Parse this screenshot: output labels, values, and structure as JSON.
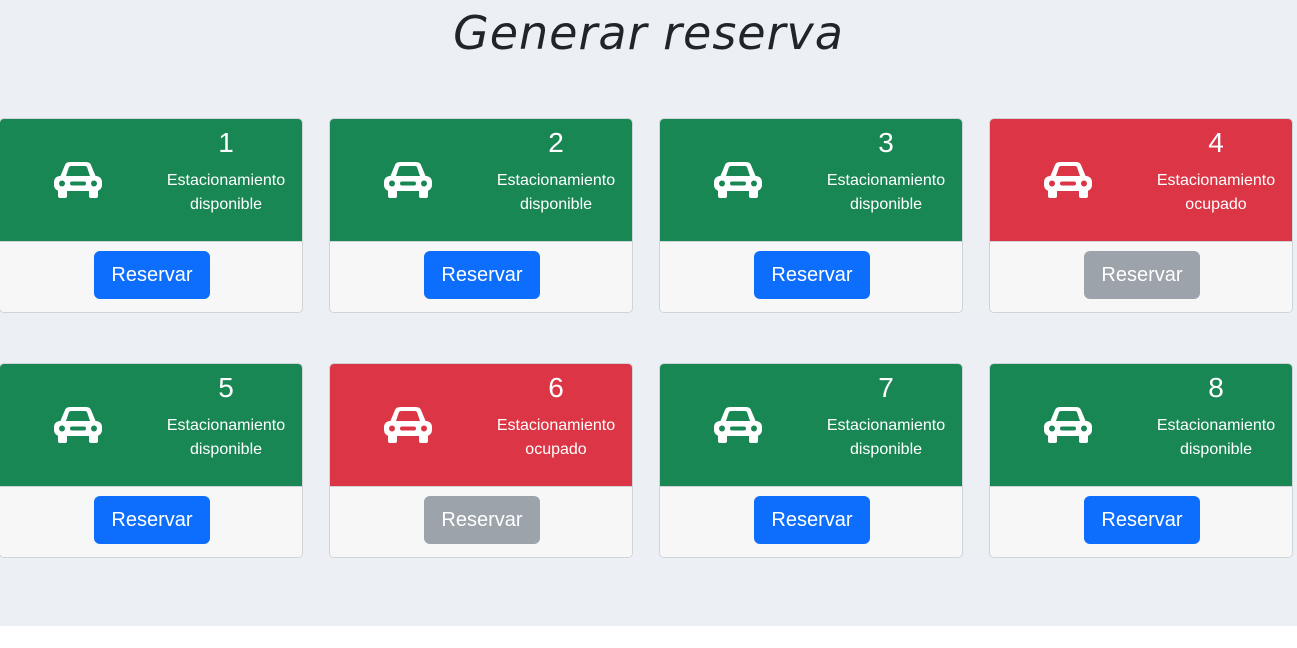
{
  "title": "Generar reserva",
  "spots": [
    {
      "number": "1",
      "status_line1": "Estacionamiento",
      "status_line2": "disponible",
      "state": "free",
      "button_label": "Reservar"
    },
    {
      "number": "2",
      "status_line1": "Estacionamiento",
      "status_line2": "disponible",
      "state": "free",
      "button_label": "Reservar"
    },
    {
      "number": "3",
      "status_line1": "Estacionamiento",
      "status_line2": "disponible",
      "state": "free",
      "button_label": "Reservar"
    },
    {
      "number": "4",
      "status_line1": "Estacionamiento",
      "status_line2": "ocupado",
      "state": "busy",
      "button_label": "Reservar"
    },
    {
      "number": "5",
      "status_line1": "Estacionamiento",
      "status_line2": "disponible",
      "state": "free",
      "button_label": "Reservar"
    },
    {
      "number": "6",
      "status_line1": "Estacionamiento",
      "status_line2": "ocupado",
      "state": "busy",
      "button_label": "Reservar"
    },
    {
      "number": "7",
      "status_line1": "Estacionamiento",
      "status_line2": "disponible",
      "state": "free",
      "button_label": "Reservar"
    },
    {
      "number": "8",
      "status_line1": "Estacionamiento",
      "status_line2": "disponible",
      "state": "free",
      "button_label": "Reservar"
    }
  ],
  "colors": {
    "free": "#198754",
    "busy": "#dc3545",
    "button_active": "#0d6efd",
    "button_disabled": "#9ca3ab"
  },
  "icons": {
    "spot_icon": "car-icon"
  }
}
